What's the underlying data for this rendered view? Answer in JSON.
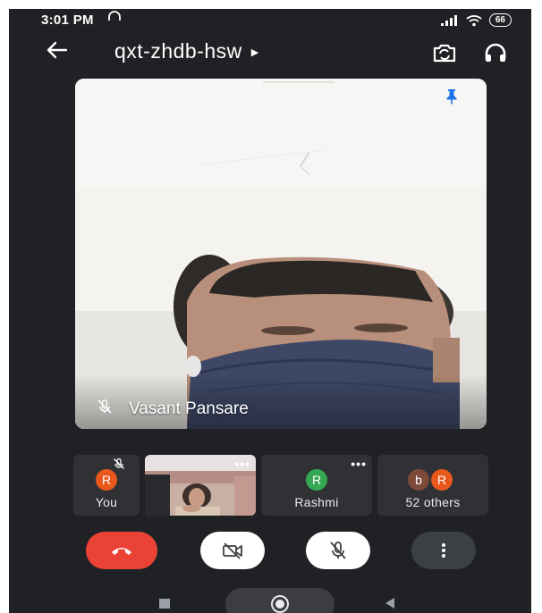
{
  "status": {
    "time": "3:01 PM",
    "battery": "66"
  },
  "header": {
    "meeting_code": "qxt-zhdb-hsw"
  },
  "main_video": {
    "name": "Vasant Pansare"
  },
  "tiles": {
    "self": {
      "initial": "R",
      "label": "You"
    },
    "participant": {
      "initial": "R",
      "label": "Rashmi"
    },
    "others": {
      "initial1": "b",
      "initial2": "R",
      "label": "52 others"
    }
  },
  "colors": {
    "end_call": "#ea4335",
    "avatar_orange": "#e8581c",
    "avatar_green": "#34a853",
    "avatar_brown": "#7d4a3a",
    "background": "#202124"
  },
  "icons": [
    "back-arrow-icon",
    "switch-camera-icon",
    "headphones-icon",
    "pin-icon",
    "mic-off-icon",
    "more-icon",
    "end-call-icon",
    "camera-off-icon",
    "more-vert-icon"
  ]
}
